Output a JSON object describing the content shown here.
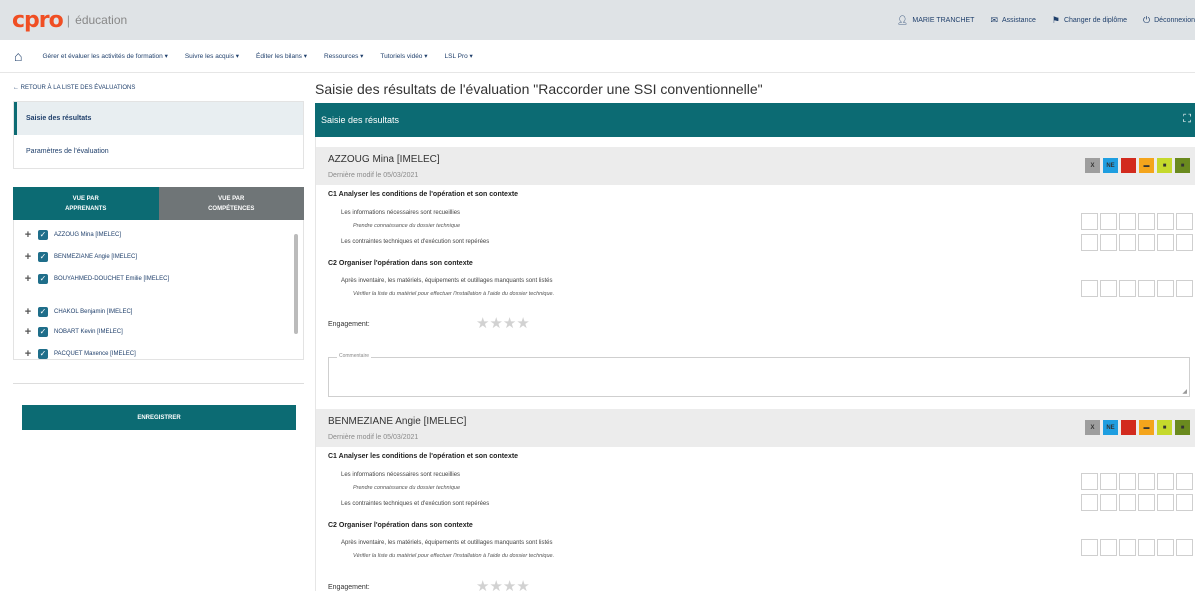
{
  "header": {
    "logo": "cpro",
    "logo_separator": "|",
    "logo_sub": "éducation",
    "user": "MARIE TRANCHET",
    "assistance": "Assistance",
    "change_diploma": "Changer de diplôme",
    "logout": "Déconnexion"
  },
  "nav": {
    "items": [
      "Gérer et évaluer les activités de formation ▾",
      "Suivre les acquis ▾",
      "Éditer les bilans ▾",
      "Ressources ▾",
      "Tutoriels vidéo ▾",
      "LSL Pro ▾"
    ]
  },
  "sidebar": {
    "back_link": "← RETOUR À LA LISTE DES ÉVALUATIONS",
    "menu": [
      "Saisie des résultats",
      "Paramètres de l'évaluation"
    ],
    "view_tabs": [
      {
        "line1": "VUE PAR",
        "line2": "APPRENANTS"
      },
      {
        "line1": "VUE PAR",
        "line2": "COMPÉTENCES"
      }
    ],
    "students": [
      "AZZOUG Mina [IMELEC]",
      "BENMEZIANE Angie [IMELEC]",
      "BOUYAHMED-DOUCHET Emilie [IMELEC]",
      "CHAKOL Benjamin [IMELEC]",
      "NOBART Kevin [IMELEC]",
      "PACQUET Maxence [IMELEC]"
    ],
    "save_button": "ENREGISTRER"
  },
  "main": {
    "title": "Saisie des résultats de l'évaluation \"Raccorder une SSI conventionnelle\"",
    "panel_title": "Saisie des résultats",
    "level_labels": [
      "X",
      "NE",
      "",
      "",
      "",
      ""
    ],
    "level_colors": [
      "#9e9e9e",
      "#1e9ee0",
      "#d22a1e",
      "#f4a51c",
      "#c5d92c",
      "#6a8a1e"
    ],
    "cards": [
      {
        "name": "AZZOUG Mina [IMELEC]",
        "modified": "Dernière modif le 05/03/2021",
        "c1": "C1 Analyser les conditions de l'opération et son contexte",
        "c1_sub1": "Les informations nécessaires sont recueillies",
        "c1_hint1": "Prendre connaissance du dossier technique",
        "c1_sub2": "Les contraintes techniques et d'exécution sont repérées",
        "c2": "C2 Organiser l'opération dans son contexte",
        "c2_sub1": "Après inventaire, les matériels, équipements et outillages manquants sont listés",
        "c2_hint1": "Vérifier la liste du matériel pour effectuer l'installation à l'aide du dossier technique.",
        "engagement": "Engagement:",
        "stars": "★★★★",
        "comment_label": "Commentaire"
      },
      {
        "name": "BENMEZIANE Angie [IMELEC]",
        "modified": "Dernière modif le 05/03/2021",
        "c1": "C1 Analyser les conditions de l'opération et son contexte",
        "c1_sub1": "Les informations nécessaires sont recueillies",
        "c1_hint1": "Prendre connaissance du dossier technique",
        "c1_sub2": "Les contraintes techniques et d'exécution sont repérées",
        "c2": "C2 Organiser l'opération dans son contexte",
        "c2_sub1": "Après inventaire, les matériels, équipements et outillages manquants sont listés",
        "c2_hint1": "Vérifier la liste du matériel pour effectuer l'installation à l'aide du dossier technique.",
        "engagement": "Engagement:",
        "stars": "★★★★"
      }
    ]
  }
}
